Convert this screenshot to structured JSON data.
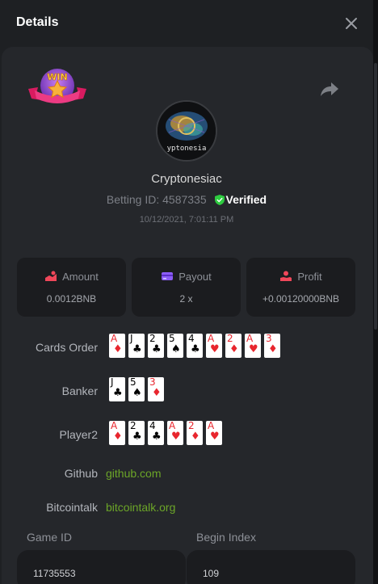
{
  "header": {
    "title": "Details"
  },
  "badge": {
    "text": "WIN"
  },
  "user": {
    "name": "Cryptonesiac",
    "avatar_caption": "yptonesia",
    "betting_id_label": "Betting ID: 4587335",
    "verified_label": "Verified",
    "date": "10/12/2021, 7:01:11 PM"
  },
  "stats": [
    {
      "label": "Amount",
      "value": "0.0012BNB",
      "icon": "coins-icon"
    },
    {
      "label": "Payout",
      "value": "2 x",
      "icon": "card-icon"
    },
    {
      "label": "Profit",
      "value": "+0.00120000BNB",
      "icon": "hand-coin-icon"
    }
  ],
  "rows": {
    "cards_order": {
      "label": "Cards Order",
      "cards": [
        {
          "rank": "A",
          "suit": "♦",
          "color": "red"
        },
        {
          "rank": "J",
          "suit": "♣",
          "color": "black"
        },
        {
          "rank": "2",
          "suit": "♣",
          "color": "black"
        },
        {
          "rank": "5",
          "suit": "♠",
          "color": "black"
        },
        {
          "rank": "4",
          "suit": "♣",
          "color": "black"
        },
        {
          "rank": "A",
          "suit": "♥",
          "color": "red"
        },
        {
          "rank": "2",
          "suit": "♦",
          "color": "red"
        },
        {
          "rank": "A",
          "suit": "♥",
          "color": "red"
        },
        {
          "rank": "3",
          "suit": "♦",
          "color": "red"
        }
      ]
    },
    "banker": {
      "label": "Banker",
      "cards": [
        {
          "rank": "J",
          "suit": "♣",
          "color": "black"
        },
        {
          "rank": "5",
          "suit": "♠",
          "color": "black"
        },
        {
          "rank": "3",
          "suit": "♦",
          "color": "red"
        }
      ]
    },
    "player2": {
      "label": "Player2",
      "cards": [
        {
          "rank": "A",
          "suit": "♦",
          "color": "red"
        },
        {
          "rank": "2",
          "suit": "♣",
          "color": "black"
        },
        {
          "rank": "4",
          "suit": "♣",
          "color": "black"
        },
        {
          "rank": "A",
          "suit": "♥",
          "color": "red"
        },
        {
          "rank": "2",
          "suit": "♦",
          "color": "red"
        },
        {
          "rank": "A",
          "suit": "♥",
          "color": "red"
        }
      ]
    }
  },
  "links": {
    "github": {
      "label": "Github",
      "text": "github.com"
    },
    "bitcointalk": {
      "label": "Bitcointalk",
      "text": "bitcointalk.org"
    }
  },
  "fields": {
    "game_id": {
      "label": "Game ID",
      "value": "11735553"
    },
    "begin_index": {
      "label": "Begin Index",
      "value": "109"
    }
  },
  "colors": {
    "accent_green": "#6ca628",
    "verified_green": "#2ecc40",
    "icon_red": "#f0475a",
    "icon_purple": "#8b5cf6",
    "card_red": "#e8262e"
  }
}
